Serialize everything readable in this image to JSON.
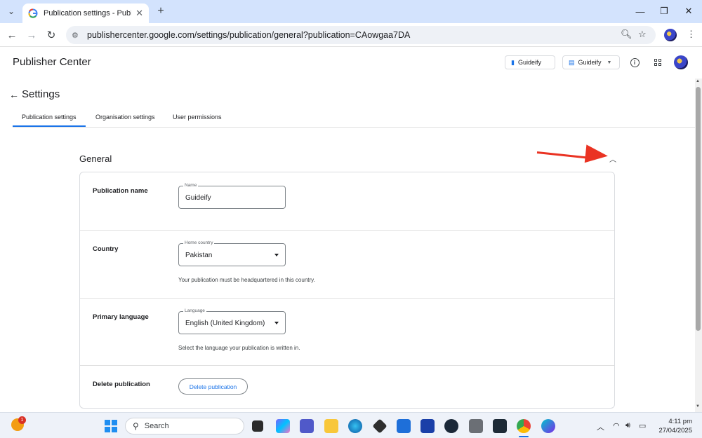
{
  "browser": {
    "tab_title": "Publication settings - Publisher",
    "tab_close": "✕",
    "new_tab": "+",
    "url": "publishercenter.google.com/settings/publication/general?publication=CAowgaa7DA"
  },
  "app": {
    "title": "Publisher Center",
    "publication_chip_1": "Guideify",
    "publication_chip_2": "Guideify"
  },
  "settings": {
    "title": "Settings",
    "tabs": [
      {
        "label": "Publication settings"
      },
      {
        "label": "Organisation settings"
      },
      {
        "label": "User permissions"
      }
    ],
    "active_tab": "Publication settings"
  },
  "general": {
    "title": "General",
    "rows": {
      "publication_name": {
        "label": "Publication name",
        "field_legend": "Name",
        "value": "Guideify"
      },
      "country": {
        "label": "Country",
        "field_legend": "Home country",
        "value": "Pakistan",
        "helper": "Your publication must be headquartered in this country."
      },
      "language": {
        "label": "Primary language",
        "field_legend": "Language",
        "value": "English (United Kingdom)",
        "helper": "Select the language your publication is written in."
      },
      "delete": {
        "label": "Delete publication",
        "button": "Delete publication"
      }
    }
  },
  "annotation": {
    "arrow_color": "#ea3323"
  },
  "taskbar": {
    "weather_badge": "1",
    "search_placeholder": "Search",
    "time": "4:11 pm",
    "date": "27/04/2025"
  },
  "colors": {
    "accent": "#1a73e8",
    "tabstrip": "#d3e3fd"
  }
}
